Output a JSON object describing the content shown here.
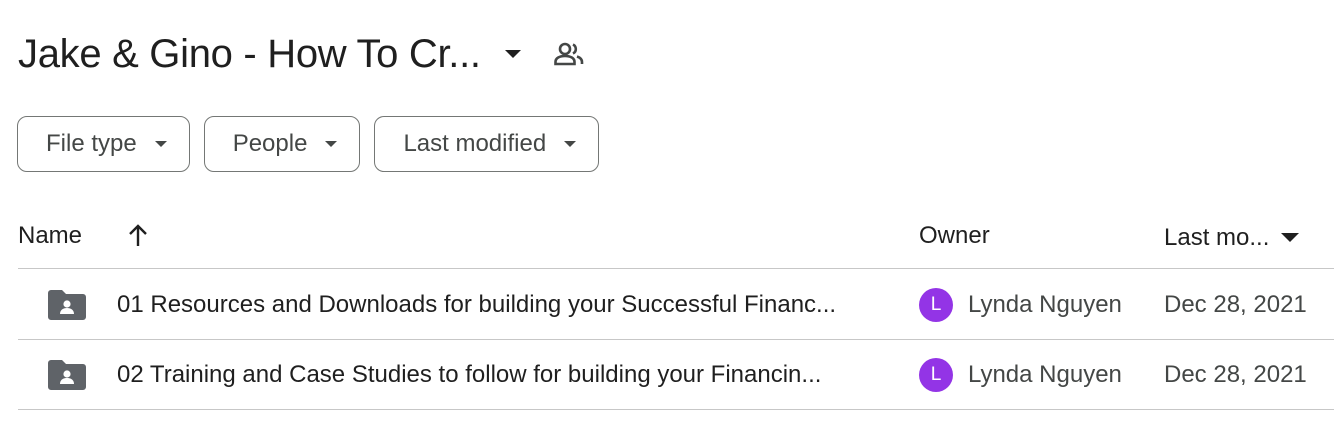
{
  "header": {
    "title": "Jake & Gino - How To Cr...",
    "title_menu_icon": "caret-down-icon",
    "shared_icon": "people-icon"
  },
  "filters": [
    {
      "label": "File type",
      "icon": "caret-down-icon"
    },
    {
      "label": "People",
      "icon": "caret-down-icon"
    },
    {
      "label": "Last modified",
      "icon": "caret-down-icon"
    }
  ],
  "table": {
    "columns": {
      "name": "Name",
      "owner": "Owner",
      "last_modified": "Last mo..."
    },
    "sort_icon": "arrow-up-icon",
    "rows": [
      {
        "icon": "shared-folder-icon",
        "name": "01 Resources and Downloads for building your Successful Financ...",
        "owner_initial": "L",
        "owner": "Lynda Nguyen",
        "date": "Dec 28, 2021"
      },
      {
        "icon": "shared-folder-icon",
        "name": "02 Training and Case Studies to follow for building your Financin...",
        "owner_initial": "L",
        "owner": "Lynda Nguyen",
        "date": "Dec 28, 2021"
      }
    ]
  },
  "colors": {
    "avatar": "#9334e6",
    "text_primary": "#1f1f1f",
    "text_secondary": "#444746",
    "divider": "#c7c7c7",
    "chip_border": "#747775"
  }
}
